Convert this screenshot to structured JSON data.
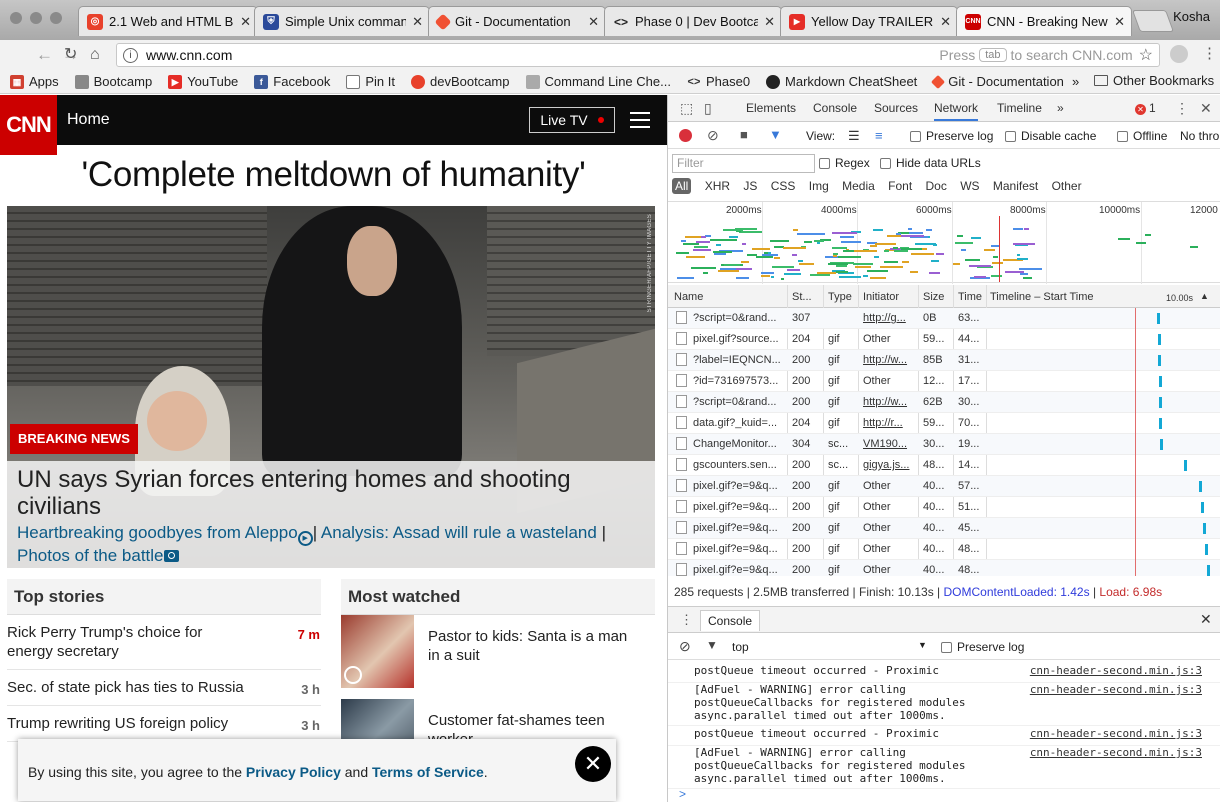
{
  "browser": {
    "profile": "Kosha",
    "tabs": [
      {
        "title": "2.1 Web and HTML B",
        "icon": "devbootcamp-icon",
        "color": "#e8412b"
      },
      {
        "title": "Simple Unix command",
        "icon": "shield-icon",
        "color": "#2b4a9a"
      },
      {
        "title": "Git - Documentation",
        "icon": "git-icon",
        "color": "#f05133"
      },
      {
        "title": "Phase 0 | Dev Bootca",
        "icon": "code-icon",
        "color": "#333333"
      },
      {
        "title": "Yellow Day TRAILER",
        "icon": "youtube-icon",
        "color": "#e52d27"
      },
      {
        "title": "CNN - Breaking News",
        "icon": "cnn-icon",
        "color": "#cc0000"
      }
    ],
    "url": "www.cnn.com",
    "search_hint_pre": "Press",
    "search_hint_key": "tab",
    "search_hint_post": "to search CNN.com",
    "bookmarks": [
      {
        "label": "Apps",
        "color": "#d04030"
      },
      {
        "label": "Bootcamp",
        "color": "#888888"
      },
      {
        "label": "YouTube",
        "color": "#e52d27"
      },
      {
        "label": "Facebook",
        "color": "#3b5998"
      },
      {
        "label": "Pin It",
        "color": "#777777"
      },
      {
        "label": "devBootcamp",
        "color": "#e8412b"
      },
      {
        "label": "Command Line Che...",
        "color": "#999999"
      },
      {
        "label": "Phase0",
        "color": "#333333"
      },
      {
        "label": "Markdown CheatSheet",
        "color": "#222222"
      },
      {
        "label": "Git - Documentation",
        "color": "#f05133"
      }
    ],
    "bookmarks_more": "»",
    "other_bookmarks": "Other Bookmarks"
  },
  "cnn": {
    "logo": "CNN",
    "home": "Home",
    "live_tv": "Live TV",
    "headline": "'Complete meltdown of humanity'",
    "photo_credit": "STRINGER/AFP/GETTY IMAGES",
    "breaking": "BREAKING NEWS",
    "hero_title": "UN says Syrian forces entering homes and shooting civilians",
    "hero_link1": "Heartbreaking goodbyes from Aleppo",
    "hero_sep1": "|",
    "hero_link2": "Analysis: Assad will rule a wasteland",
    "hero_sep2": "|",
    "hero_link3": "Photos of the battle",
    "top_stories_heading": "Top stories",
    "top_stories": [
      {
        "title": "Rick Perry Trump's choice for energy secretary",
        "time": "7 m"
      },
      {
        "title": "Sec. of state pick has ties to Russia",
        "time": "3 h"
      },
      {
        "title": "Trump rewriting US foreign policy",
        "time": "3 h"
      }
    ],
    "most_watched_heading": "Most watched",
    "most_watched": [
      {
        "title": "Pastor to kids: Santa is a man in a suit"
      },
      {
        "title": "Customer fat-shames teen worker"
      }
    ],
    "consent_pre": "By using this site, you agree to the",
    "consent_privacy": "Privacy Policy",
    "consent_and": "and",
    "consent_terms": "Terms of Service",
    "consent_end": ".",
    "consent_close": "✕"
  },
  "devtools": {
    "tabs": [
      "Elements",
      "Console",
      "Sources",
      "Network",
      "Timeline"
    ],
    "active_tab": "Network",
    "more": "»",
    "error_count": "1",
    "view_label": "View:",
    "preserve_log": "Preserve log",
    "disable_cache": "Disable cache",
    "offline": "Offline",
    "throttle": "No thro",
    "filter_placeholder": "Filter",
    "regex": "Regex",
    "hide_data_urls": "Hide data URLs",
    "types": [
      "All",
      "XHR",
      "JS",
      "CSS",
      "Img",
      "Media",
      "Font",
      "Doc",
      "WS",
      "Manifest",
      "Other"
    ],
    "overview_ticks": [
      "2000ms",
      "4000ms",
      "6000ms",
      "8000ms",
      "10000ms",
      "12000"
    ],
    "columns": [
      "Name",
      "St...",
      "Type",
      "Initiator",
      "Size",
      "Time",
      "Timeline – Start Time",
      "10.00s"
    ],
    "rows": [
      {
        "name": "?script=0&rand...",
        "status": "307",
        "type": "",
        "initiator": "http://g...",
        "size": "0B",
        "time": "63..."
      },
      {
        "name": "pixel.gif?source...",
        "status": "204",
        "type": "gif",
        "initiator": "Other",
        "size": "59...",
        "time": "44..."
      },
      {
        "name": "?label=IEQNCN...",
        "status": "200",
        "type": "gif",
        "initiator": "http://w...",
        "size": "85B",
        "time": "31..."
      },
      {
        "name": "?id=731697573...",
        "status": "200",
        "type": "gif",
        "initiator": "Other",
        "size": "12...",
        "time": "17..."
      },
      {
        "name": "?script=0&rand...",
        "status": "200",
        "type": "gif",
        "initiator": "http://w...",
        "size": "62B",
        "time": "30..."
      },
      {
        "name": "data.gif?_kuid=...",
        "status": "204",
        "type": "gif",
        "initiator": "http://r...",
        "size": "59...",
        "time": "70..."
      },
      {
        "name": "ChangeMonitor...",
        "status": "304",
        "type": "sc...",
        "initiator": "VM190...",
        "size": "30...",
        "time": "19..."
      },
      {
        "name": "gscounters.sen...",
        "status": "200",
        "type": "sc...",
        "initiator": "gigya.js...",
        "size": "48...",
        "time": "14..."
      },
      {
        "name": "pixel.gif?e=9&q...",
        "status": "200",
        "type": "gif",
        "initiator": "Other",
        "size": "40...",
        "time": "57..."
      },
      {
        "name": "pixel.gif?e=9&q...",
        "status": "200",
        "type": "gif",
        "initiator": "Other",
        "size": "40...",
        "time": "51..."
      },
      {
        "name": "pixel.gif?e=9&q...",
        "status": "200",
        "type": "gif",
        "initiator": "Other",
        "size": "40...",
        "time": "45..."
      },
      {
        "name": "pixel.gif?e=9&q...",
        "status": "200",
        "type": "gif",
        "initiator": "Other",
        "size": "40...",
        "time": "48..."
      },
      {
        "name": "pixel.gif?e=9&q...",
        "status": "200",
        "type": "gif",
        "initiator": "Other",
        "size": "40...",
        "time": "48..."
      }
    ],
    "summary_main": "285 requests | 2.5MB transferred | Finish: 10.13s |",
    "summary_dcl": "DOMContentLoaded: 1.42s",
    "summary_sep": "|",
    "summary_load": "Load: 6.98s",
    "drawer_tab": "Console",
    "context": "top",
    "console_preserve": "Preserve log",
    "logs": [
      {
        "text": "postQueue timeout occurred - Proximic",
        "src": "cnn-header-second.min.js:3"
      },
      {
        "text": "[AdFuel - WARNING] error calling postQueueCallbacks for registered modules async.parallel timed out after 1000ms.",
        "src": "cnn-header-second.min.js:3"
      },
      {
        "text": "postQueue timeout occurred - Proximic",
        "src": "cnn-header-second.min.js:3"
      },
      {
        "text": "[AdFuel - WARNING] error calling postQueueCallbacks for registered modules async.parallel timed out after 1000ms.",
        "src": "cnn-header-second.min.js:3"
      }
    ],
    "prompt": ">"
  }
}
